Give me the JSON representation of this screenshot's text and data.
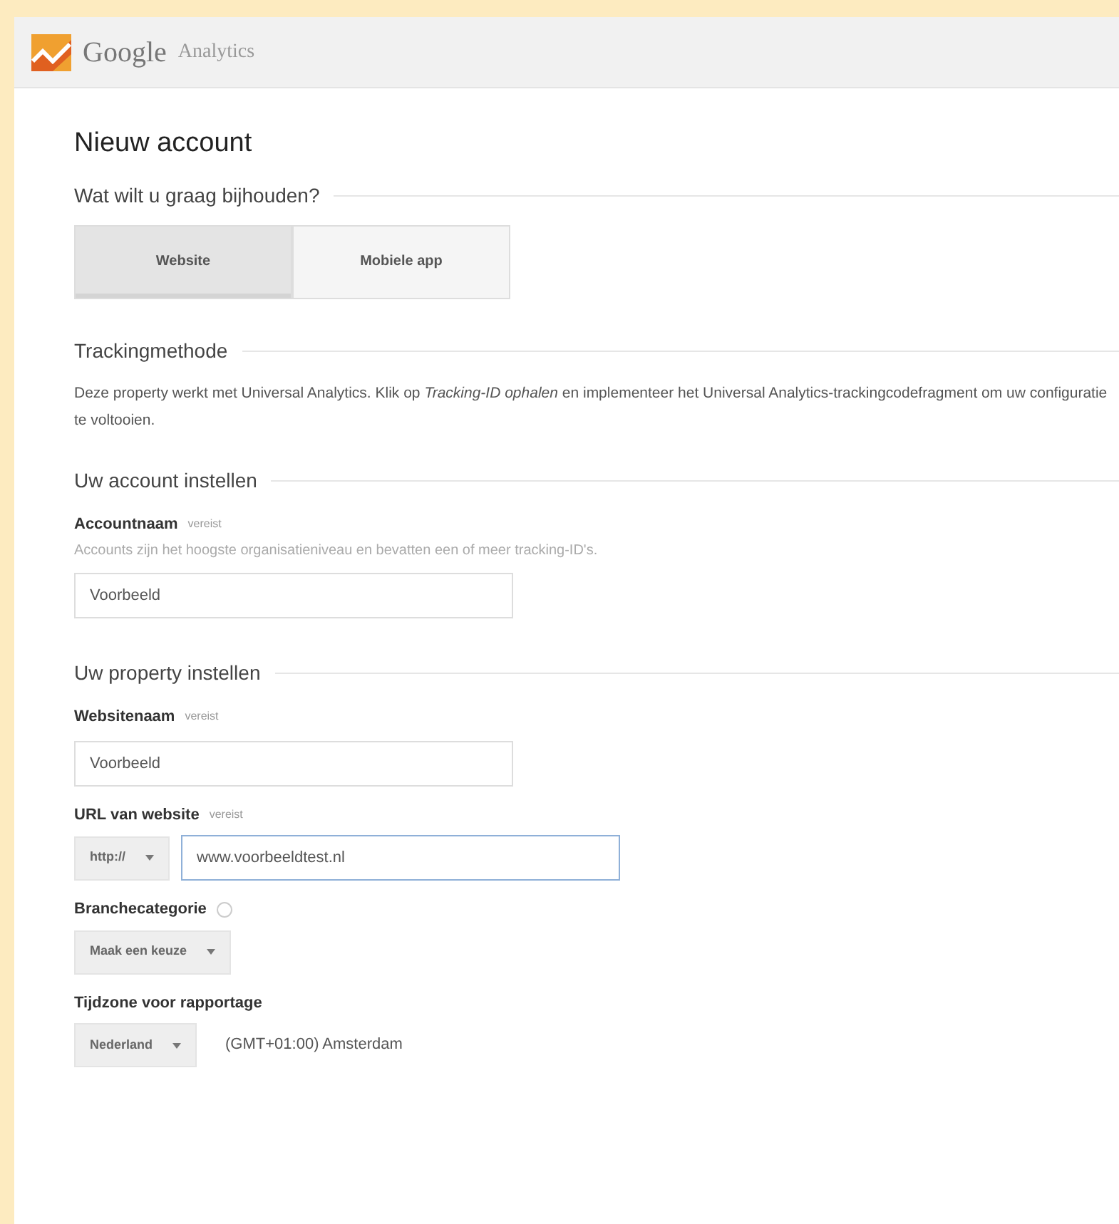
{
  "header": {
    "brand": "Google",
    "product": "Analytics"
  },
  "title": "Nieuw account",
  "track_section": {
    "heading": "Wat wilt u graag bijhouden?",
    "tabs": [
      {
        "label": "Website",
        "selected": true
      },
      {
        "label": "Mobiele app",
        "selected": false
      }
    ]
  },
  "method_section": {
    "heading": "Trackingmethode",
    "text": "Deze property werkt met Universal Analytics. Klik op *Tracking-ID ophalen* en implementeer het Universal Analytics-trackingcodefragment om uw configuratie te voltooien."
  },
  "sections": [
    {
      "heading": "Uw account instellen",
      "fields": [
        {
          "kind": "input",
          "label": "Accountnaam",
          "required": "vereist",
          "help": "Accounts zijn het hoogste organisatieniveau en bevatten een of meer tracking-ID's.",
          "value": "Voorbeeld"
        }
      ]
    },
    {
      "heading": "Uw property instellen",
      "fields": [
        {
          "kind": "input",
          "label": "Websitenaam",
          "required": "vereist",
          "value": "Voorbeeld"
        },
        {
          "kind": "select-input",
          "label": "URL van website",
          "required": "vereist",
          "select": "http://",
          "value": "www.voorbeeldtest.nl",
          "focused": true
        },
        {
          "kind": "select",
          "label": "Branchecategorie",
          "info": true,
          "select": "Maak een keuze"
        },
        {
          "kind": "select-text",
          "label": "Tijdzone voor rapportage",
          "select": "Nederland",
          "text": "(GMT+01:00) Amsterdam"
        }
      ]
    }
  ]
}
